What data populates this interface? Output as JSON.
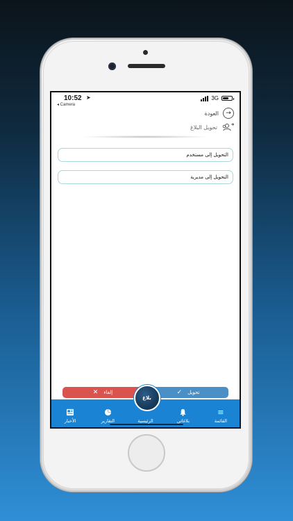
{
  "status_bar": {
    "time": "10:52",
    "network": "3G",
    "back_to_app": "◂ Camera",
    "battery_level": 0.7
  },
  "header": {
    "back_label": "العودة",
    "title": "تحويل البلاغ"
  },
  "options": [
    {
      "label": "التحويل إلى مستخدم"
    },
    {
      "label": "التحويل إلى مديرية"
    }
  ],
  "actions": {
    "transfer_label": "تحويل",
    "cancel_label": "إلغاء"
  },
  "tabbar": {
    "items": [
      {
        "label": "القائمة",
        "icon": "menu-icon"
      },
      {
        "label": "بلاغاتي",
        "icon": "bell-icon"
      },
      {
        "label": "الرئيسية",
        "icon": "home-logo"
      },
      {
        "label": "التقارير",
        "icon": "pie-chart-icon"
      },
      {
        "label": "الأخبار",
        "icon": "news-icon"
      }
    ],
    "logo_text": "بلاغ",
    "accent": "#1b83d4"
  }
}
